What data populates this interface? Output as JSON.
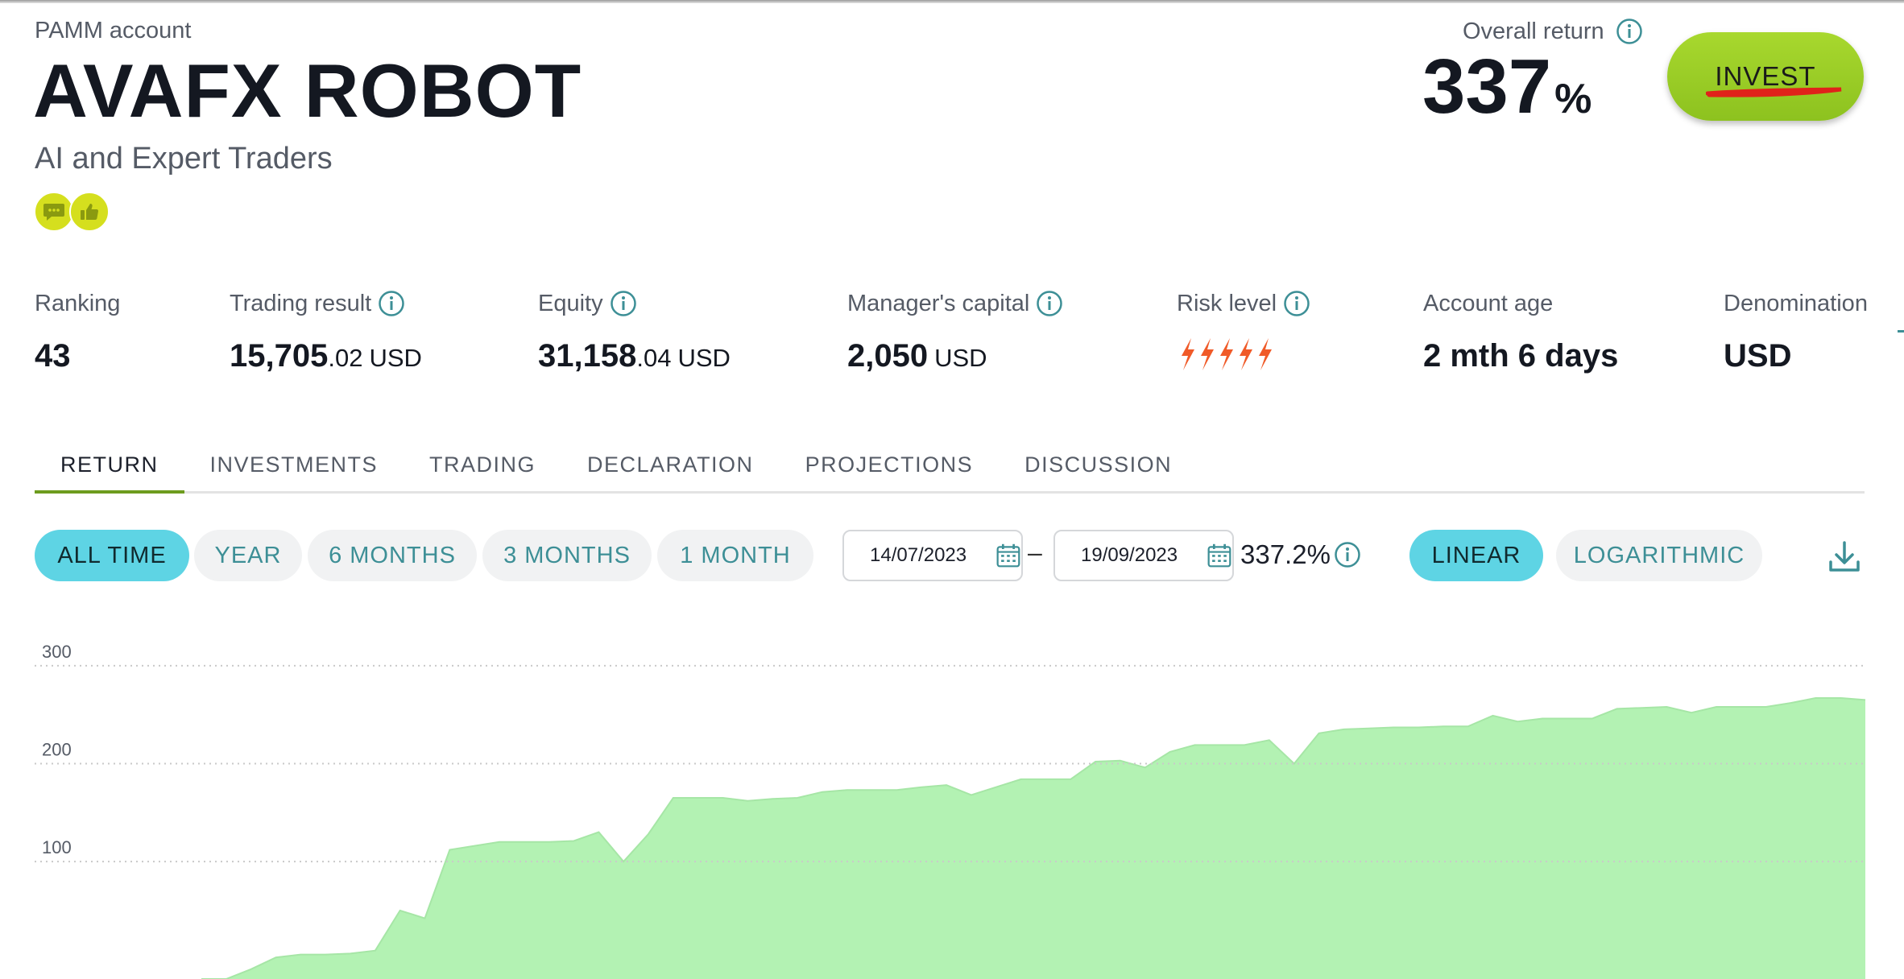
{
  "header": {
    "kicker": "PAMM account",
    "title": "AVAFX ROBOT",
    "subtitle": "AI and Expert Traders",
    "badges": [
      "chat-bubble-icon",
      "thumbs-up-icon"
    ],
    "overall_return_label": "Overall return",
    "overall_return_value": "337",
    "overall_return_unit": "%",
    "invest_label": "INVEST"
  },
  "stats": {
    "ranking": {
      "label": "Ranking",
      "value": "43"
    },
    "trading_result": {
      "label": "Trading result",
      "int": "15,705",
      "dec": ".02",
      "currency": "USD"
    },
    "equity": {
      "label": "Equity",
      "int": "31,158",
      "dec": ".04",
      "currency": "USD"
    },
    "managers_capital": {
      "label": "Manager's capital",
      "int": "2,050",
      "currency": "USD"
    },
    "risk_level": {
      "label": "Risk level",
      "bolts": 5
    },
    "account_age": {
      "label": "Account age",
      "value": "2 mth 6 days"
    },
    "denomination": {
      "label": "Denomination",
      "value": "USD"
    }
  },
  "tabs": [
    {
      "label": "RETURN",
      "active": true
    },
    {
      "label": "INVESTMENTS",
      "active": false
    },
    {
      "label": "TRADING",
      "active": false
    },
    {
      "label": "DECLARATION",
      "active": false
    },
    {
      "label": "PROJECTIONS",
      "active": false
    },
    {
      "label": "DISCUSSION",
      "active": false
    }
  ],
  "periods": [
    {
      "label": "ALL TIME",
      "active": true
    },
    {
      "label": "YEAR",
      "active": false
    },
    {
      "label": "6 MONTHS",
      "active": false
    },
    {
      "label": "3 MONTHS",
      "active": false
    },
    {
      "label": "1 MONTH",
      "active": false
    }
  ],
  "date_range": {
    "from": "14/07/2023",
    "separator": "–",
    "to": "19/09/2023",
    "return": "337.2%"
  },
  "scale": [
    {
      "label": "LINEAR",
      "active": true
    },
    {
      "label": "LOGARITHMIC",
      "active": false
    }
  ],
  "colors": {
    "accent_teal": "#5ed4e4",
    "teal_text": "#3d8f96",
    "invest_green": "#9acd28",
    "area_fill": "#b3f2b3",
    "risk_orange": "#f05a28"
  },
  "chart_data": {
    "type": "area",
    "y_ticks": [
      100,
      200,
      300
    ],
    "ylim": [
      -20,
      355
    ],
    "grid": true,
    "x": [
      0,
      1,
      2,
      3,
      4,
      5,
      6,
      7,
      8,
      9,
      10,
      11,
      12,
      13,
      14,
      15,
      16,
      17,
      18,
      19,
      20,
      21,
      22,
      23,
      24,
      25,
      26,
      27,
      28,
      29,
      30,
      31,
      32,
      33,
      34,
      35,
      36,
      37,
      38,
      39,
      40,
      41,
      42,
      43,
      44,
      45,
      46,
      47,
      48,
      49,
      50,
      51,
      52,
      53,
      54,
      55,
      56,
      57,
      58,
      59,
      60,
      61,
      62,
      63,
      64,
      65,
      66,
      67
    ],
    "values": [
      -20,
      -20,
      -10,
      2,
      5,
      5,
      6,
      9,
      50,
      42,
      112,
      116,
      120,
      120,
      120,
      121,
      130,
      100,
      128,
      165,
      165,
      165,
      162,
      164,
      165,
      171,
      173,
      173,
      173,
      176,
      178,
      168,
      176,
      184,
      184,
      184,
      202,
      203,
      196,
      212,
      219,
      219,
      219,
      224,
      200,
      231,
      235,
      236,
      237,
      237,
      238,
      238,
      249,
      243,
      246,
      246,
      246,
      256,
      257,
      258,
      252,
      258,
      258,
      258,
      262,
      267,
      267,
      265
    ]
  }
}
